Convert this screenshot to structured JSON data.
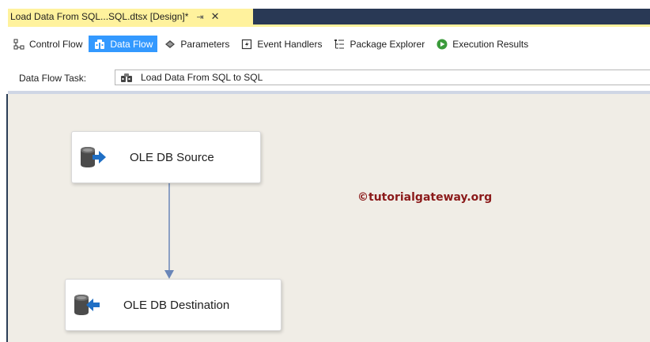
{
  "document_tab": {
    "title": "Load Data From SQL...SQL.dtsx [Design]*",
    "pin_glyph": "⇥",
    "close_glyph": "✕"
  },
  "designer_tabs": [
    {
      "label": "Control Flow",
      "icon": "control-flow-icon",
      "active": false
    },
    {
      "label": "Data Flow",
      "icon": "data-flow-icon",
      "active": true
    },
    {
      "label": "Parameters",
      "icon": "parameters-icon",
      "active": false
    },
    {
      "label": "Event Handlers",
      "icon": "event-handlers-icon",
      "active": false
    },
    {
      "label": "Package Explorer",
      "icon": "package-explorer-icon",
      "active": false
    },
    {
      "label": "Execution Results",
      "icon": "execution-results-icon",
      "active": false
    }
  ],
  "task_bar": {
    "label": "Data Flow Task:",
    "selected_task": "Load Data From SQL to SQL"
  },
  "components": {
    "source": {
      "label": "OLE DB Source",
      "icon": "database-source-icon"
    },
    "destination": {
      "label": "OLE DB Destination",
      "icon": "database-destination-icon"
    }
  },
  "watermark": "©tutorialgateway.org",
  "colors": {
    "active_tab": "#3399ff",
    "document_tab": "#fff29d",
    "canvas": "#f0ede6",
    "connector": "#6a86b8",
    "watermark": "#8b1a1a"
  }
}
